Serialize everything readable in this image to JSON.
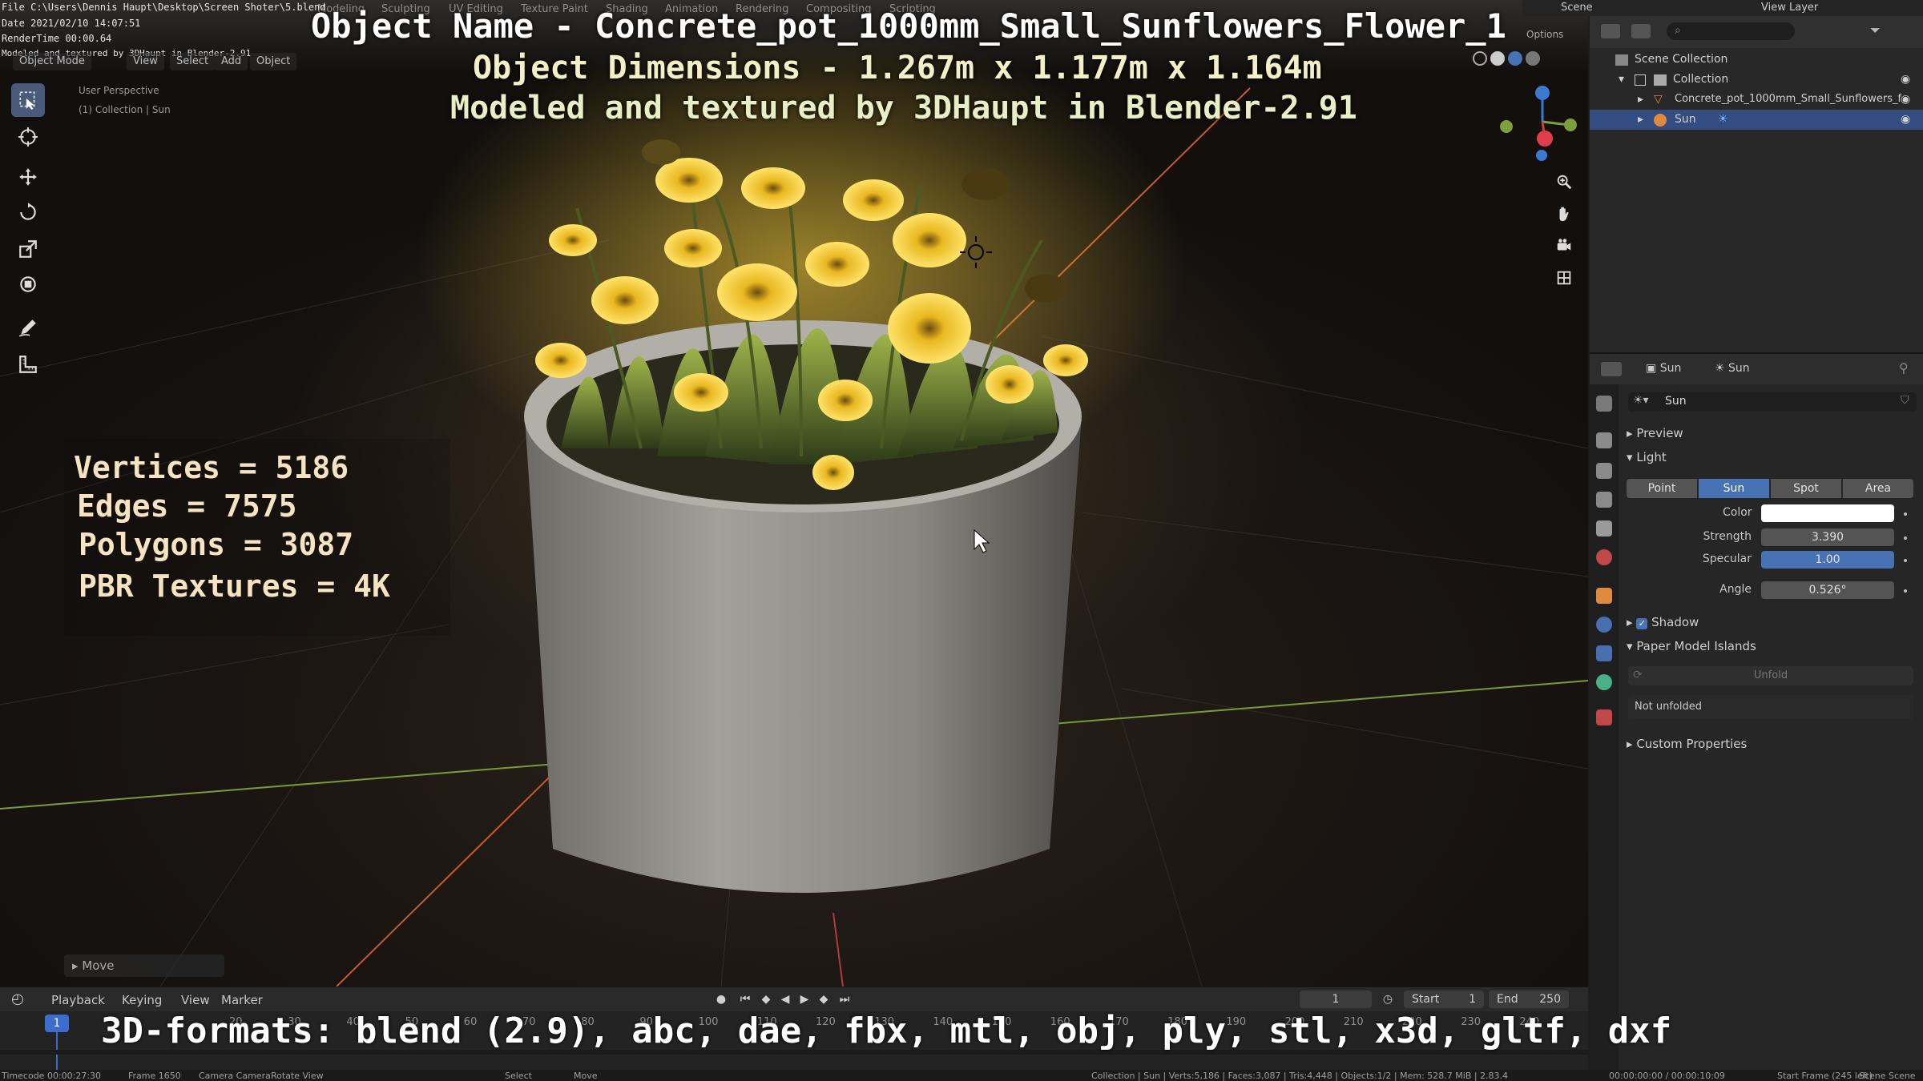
{
  "overlay": {
    "file_path": "File C:\\Users\\Dennis Haupt\\Desktop\\Screen Shoter\\5.blend",
    "date": "Date 2021/02/10 14:07:51",
    "render_time": "RenderTime 00:00.64",
    "modeled_small": "Modeled and textured by 3DHaupt in Blender-2.91",
    "title_name": "Object Name - Concrete_pot_1000mm_Small_Sunflowers_Flower_1",
    "title_dims": "Object Dimensions -  1.267m x 1.177m x 1.164m",
    "title_model": "Modeled and textured by 3DHaupt in Blender-2.91",
    "stats": [
      "Vertices = 5186",
      "Edges = 7575",
      "Polygons = 3087",
      "PBR Textures = 4K"
    ],
    "formats": "3D-formats: blend (2.9), abc, dae, fbx, mtl, obj, ply, stl, x3d, gltf, dxf"
  },
  "workspace_tabs": [
    "Modeling",
    "Sculpting",
    "UV Editing",
    "Texture Paint",
    "Shading",
    "Animation",
    "Rendering",
    "Compositing",
    "Scripting"
  ],
  "viewport": {
    "mode": "Object Mode",
    "menus": [
      "View",
      "Select",
      "Add",
      "Object"
    ],
    "perspective": "User Perspective",
    "collection_info": "(1) Collection | Sun",
    "operator": "Move",
    "options": "Options"
  },
  "timeline": {
    "menus": [
      "Playback",
      "Keying",
      "View",
      "Marker"
    ],
    "current_frame": "1",
    "start_label": "Start",
    "start": "1",
    "end_label": "End",
    "end": "250",
    "ticks": [
      "20",
      "30",
      "40",
      "50",
      "60",
      "70",
      "80",
      "90",
      "100",
      "110",
      "120",
      "130",
      "140",
      "150",
      "160",
      "170",
      "180",
      "190",
      "200",
      "210",
      "220",
      "230",
      "240"
    ],
    "cursor": "1"
  },
  "statusbar": {
    "timecode": "Timecode 00:00:27:30",
    "frame": "Frame 1650",
    "camera": "Camera Camera",
    "rotate": "Rotate View",
    "select": "Select",
    "move": "Move",
    "stats": "Collection | Sun | Verts:5,186 | Faces:3,087 | Tris:4,448 | Objects:1/2 | Mem: 528.7 MiB | 2.83.4",
    "time": "00:00:00:00 / 00:00:10:09",
    "start_frame": "Start Frame (245 left)",
    "scene": "Scene Scene"
  },
  "top_right": {
    "scene": "Scene",
    "view_layer": "View Layer"
  },
  "outliner": {
    "scene_collection": "Scene Collection",
    "collection": "Collection",
    "object": "Concrete_pot_1000mm_Small_Sunflowers_f",
    "sun": "Sun"
  },
  "properties": {
    "header_object": "Sun",
    "header_data": "Sun",
    "data_name": "Sun",
    "panels": {
      "preview": "Preview",
      "light": "Light",
      "shadow": "Shadow",
      "paper_model": "Paper Model Islands",
      "custom": "Custom Properties"
    },
    "light_types": [
      "Point",
      "Sun",
      "Spot",
      "Area"
    ],
    "active_light_type": "Sun",
    "color_label": "Color",
    "strength_label": "Strength",
    "strength": "3.390",
    "specular_label": "Specular",
    "specular": "1.00",
    "angle_label": "Angle",
    "angle": "0.526°",
    "unfold": "Unfold",
    "not_unfolded": "Not unfolded"
  },
  "colors": {
    "accent_blue": "#4772b3",
    "selected_row": "#334d80",
    "title_text": "#ffffff",
    "stats_text": "#f6e3c2"
  }
}
